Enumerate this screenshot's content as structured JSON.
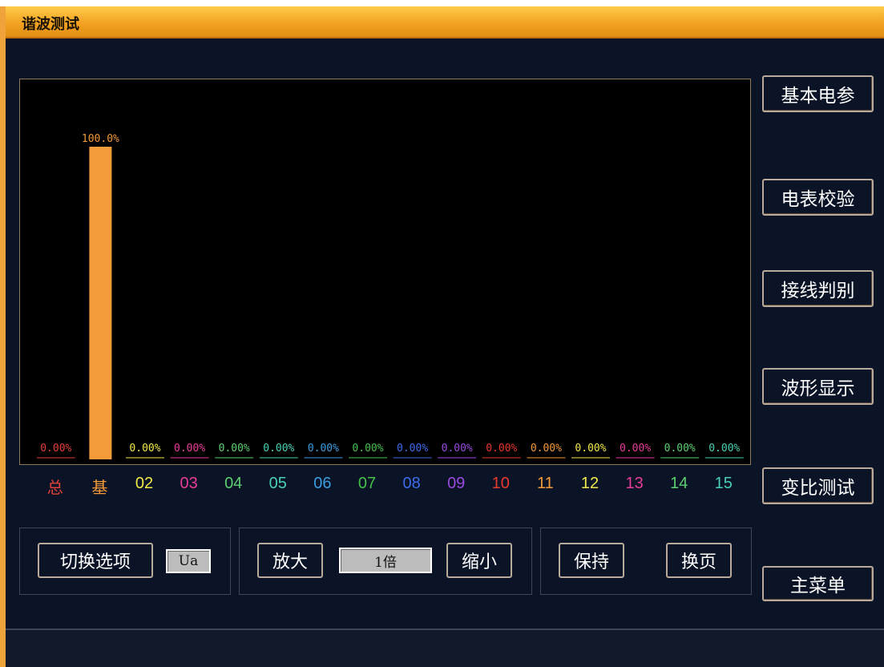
{
  "window": {
    "title": "谐波测试"
  },
  "chart_data": {
    "type": "bar",
    "categories": [
      "总",
      "基",
      "02",
      "03",
      "04",
      "05",
      "06",
      "07",
      "08",
      "09",
      "10",
      "11",
      "12",
      "13",
      "14",
      "15"
    ],
    "values": [
      0,
      100,
      0,
      0,
      0,
      0,
      0,
      0,
      0,
      0,
      0,
      0,
      0,
      0,
      0,
      0
    ],
    "value_labels": [
      "0.00%",
      "100.0%",
      "0.00%",
      "0.00%",
      "0.00%",
      "0.00%",
      "0.00%",
      "0.00%",
      "0.00%",
      "0.00%",
      "0.00%",
      "0.00%",
      "0.00%",
      "0.00%",
      "0.00%",
      "0.00%"
    ],
    "colors": [
      "#e0413a",
      "#f39a3a",
      "#f2e84a",
      "#e83d9a",
      "#5ad070",
      "#48d0b4",
      "#3a9ee0",
      "#46c24a",
      "#3c6ce8",
      "#9a4ae0",
      "#e83a2a",
      "#f39a3a",
      "#f2e84a",
      "#e83d9a",
      "#5ad070",
      "#48d0b4"
    ],
    "bar_color": "#f39a3a",
    "ylim": [
      0,
      100
    ],
    "grid": false
  },
  "side_buttons": [
    "基本电参",
    "电表校验",
    "接线判别",
    "波形显示",
    "变比测试",
    "主菜单"
  ],
  "controls": {
    "switch_label": "切换选项",
    "channel_value": "Ua",
    "zoom_in_label": "放大",
    "zoom_value": "1倍",
    "zoom_out_label": "缩小",
    "hold_label": "保持",
    "page_label": "换页"
  }
}
